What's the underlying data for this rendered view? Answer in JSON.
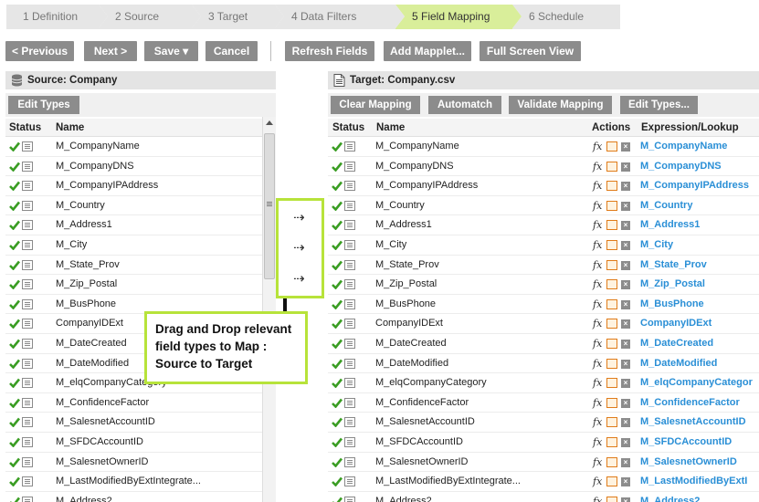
{
  "wizard": {
    "steps": [
      {
        "label": "1  Definition"
      },
      {
        "label": "2  Source"
      },
      {
        "label": "3  Target"
      },
      {
        "label": "4  Data Filters"
      },
      {
        "label": "5  Field Mapping"
      },
      {
        "label": "6  Schedule"
      }
    ]
  },
  "toolbar": {
    "previous": "< Previous",
    "next": "Next >",
    "save": "Save ▾",
    "cancel": "Cancel",
    "refresh": "Refresh Fields",
    "add_mapplet": "Add Mapplet...",
    "full_screen": "Full Screen View"
  },
  "source": {
    "title": "Source: Company",
    "edit_types": "Edit Types",
    "col_status": "Status",
    "col_name": "Name",
    "rows": [
      "M_CompanyName",
      "M_CompanyDNS",
      "M_CompanyIPAddress",
      "M_Country",
      "M_Address1",
      "M_City",
      "M_State_Prov",
      "M_Zip_Postal",
      "M_BusPhone",
      "CompanyIDExt",
      "M_DateCreated",
      "M_DateModified",
      "M_elqCompanyCategory",
      "M_ConfidenceFactor",
      "M_SalesnetAccountID",
      "M_SFDCAccountID",
      "M_SalesnetOwnerID",
      "M_LastModifiedByExtIntegrate...",
      "M_Address2"
    ]
  },
  "target": {
    "title": "Target: Company.csv",
    "clear_mapping": "Clear Mapping",
    "automatch": "Automatch",
    "validate": "Validate Mapping",
    "edit_types": "Edit Types...",
    "col_status": "Status",
    "col_name": "Name",
    "col_actions": "Actions",
    "col_expr": "Expression/Lookup",
    "fx": "fx",
    "rows": [
      {
        "name": "M_CompanyName",
        "expr": "M_CompanyName"
      },
      {
        "name": "M_CompanyDNS",
        "expr": "M_CompanyDNS"
      },
      {
        "name": "M_CompanyIPAddress",
        "expr": "M_CompanyIPAddress"
      },
      {
        "name": "M_Country",
        "expr": "M_Country"
      },
      {
        "name": "M_Address1",
        "expr": "M_Address1"
      },
      {
        "name": "M_City",
        "expr": "M_City"
      },
      {
        "name": "M_State_Prov",
        "expr": "M_State_Prov"
      },
      {
        "name": "M_Zip_Postal",
        "expr": "M_Zip_Postal"
      },
      {
        "name": "M_BusPhone",
        "expr": "M_BusPhone"
      },
      {
        "name": "CompanyIDExt",
        "expr": "CompanyIDExt"
      },
      {
        "name": "M_DateCreated",
        "expr": "M_DateCreated"
      },
      {
        "name": "M_DateModified",
        "expr": "M_DateModified"
      },
      {
        "name": "M_elqCompanyCategory",
        "expr": "M_elqCompanyCategor"
      },
      {
        "name": "M_ConfidenceFactor",
        "expr": "M_ConfidenceFactor"
      },
      {
        "name": "M_SalesnetAccountID",
        "expr": "M_SalesnetAccountID"
      },
      {
        "name": "M_SFDCAccountID",
        "expr": "M_SFDCAccountID"
      },
      {
        "name": "M_SalesnetOwnerID",
        "expr": "M_SalesnetOwnerID"
      },
      {
        "name": "M_LastModifiedByExtIntegrate...",
        "expr": "M_LastModifiedByExtI"
      },
      {
        "name": "M_Address2",
        "expr": "M_Address2"
      }
    ]
  },
  "callout": {
    "arrow": "⇢",
    "note": "Drag and Drop relevant field types to Map : Source to Target"
  },
  "colors": {
    "accent_green": "#b7e33a",
    "active_step": "#d9ee9a",
    "button_gray": "#8c8c8c",
    "link_blue": "#2a8fd6",
    "check_green": "#3a9d23"
  }
}
